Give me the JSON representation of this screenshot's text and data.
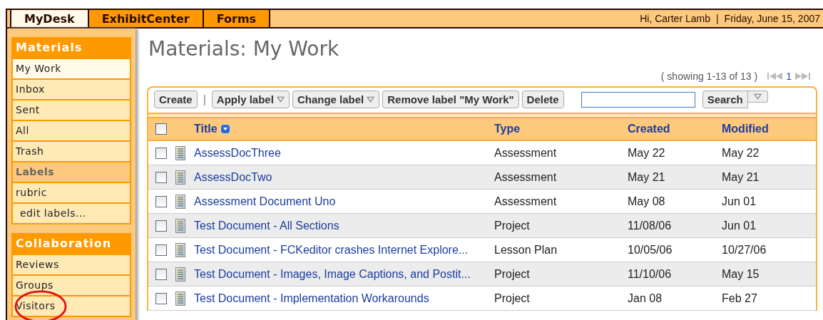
{
  "top_tabs": [
    {
      "label": "MyDesk",
      "selected": true
    },
    {
      "label": "ExhibitCenter",
      "selected": false
    },
    {
      "label": "Forms",
      "selected": false
    }
  ],
  "greeting": "Hi, Carter Lamb",
  "greeting_separator": "|",
  "date": "Friday, June 15, 2007",
  "sidebar": [
    {
      "title": "Materials",
      "items": [
        {
          "kind": "link",
          "label": "My Work",
          "selected": true
        },
        {
          "kind": "link",
          "label": "Inbox",
          "selected": false
        },
        {
          "kind": "link",
          "label": "Sent",
          "selected": false
        },
        {
          "kind": "link",
          "label": "All",
          "selected": false
        },
        {
          "kind": "link",
          "label": "Trash",
          "selected": false
        },
        {
          "kind": "heading",
          "label": "Labels",
          "selected": false
        },
        {
          "kind": "link",
          "label": "rubric",
          "selected": false
        },
        {
          "kind": "action",
          "label": "edit labels...",
          "selected": false
        }
      ]
    },
    {
      "title": "Collaboration",
      "items": [
        {
          "kind": "link",
          "label": "Reviews",
          "selected": false
        },
        {
          "kind": "link",
          "label": "Groups",
          "selected": false
        },
        {
          "kind": "link",
          "label": "Visitors",
          "selected": false
        }
      ]
    }
  ],
  "page_title": "Materials: My Work",
  "pager": {
    "summary": "( showing 1-13 of 13 )",
    "page": "1"
  },
  "toolbar": [
    {
      "kind": "button",
      "label": "Create"
    },
    {
      "kind": "separator",
      "label": "|"
    },
    {
      "kind": "menu",
      "label": "Apply label"
    },
    {
      "kind": "menu",
      "label": "Change label"
    },
    {
      "kind": "button",
      "label": "Remove label \"My Work\""
    },
    {
      "kind": "button",
      "label": "Delete"
    }
  ],
  "search": {
    "button": "Search"
  },
  "table": {
    "select_all_checked": false,
    "columns": [
      "Title",
      "Type",
      "Created",
      "Modified"
    ],
    "rows": [
      {
        "checked": false,
        "title": "AssessDocThree",
        "type": "Assessment",
        "created": "May 22",
        "modified": "May 22"
      },
      {
        "checked": false,
        "title": "AssessDocTwo",
        "type": "Assessment",
        "created": "May 21",
        "modified": "May 21"
      },
      {
        "checked": false,
        "title": "Assessment Document Uno",
        "type": "Assessment",
        "created": "May 08",
        "modified": "Jun 01"
      },
      {
        "checked": false,
        "title": "Test Document - All Sections",
        "type": "Project",
        "created": "11/08/06",
        "modified": "Jun 01"
      },
      {
        "checked": false,
        "title": "Test Document - FCKeditor crashes Internet Explore...",
        "type": "Lesson Plan",
        "created": "10/05/06",
        "modified": "10/27/06"
      },
      {
        "checked": false,
        "title": "Test Document - Images, Image Captions, and Postit...",
        "type": "Project",
        "created": "11/10/06",
        "modified": "May 15"
      },
      {
        "checked": false,
        "title": "Test Document - Implementation Workarounds",
        "type": "Project",
        "created": "Jan 08",
        "modified": "Feb 27"
      }
    ]
  }
}
